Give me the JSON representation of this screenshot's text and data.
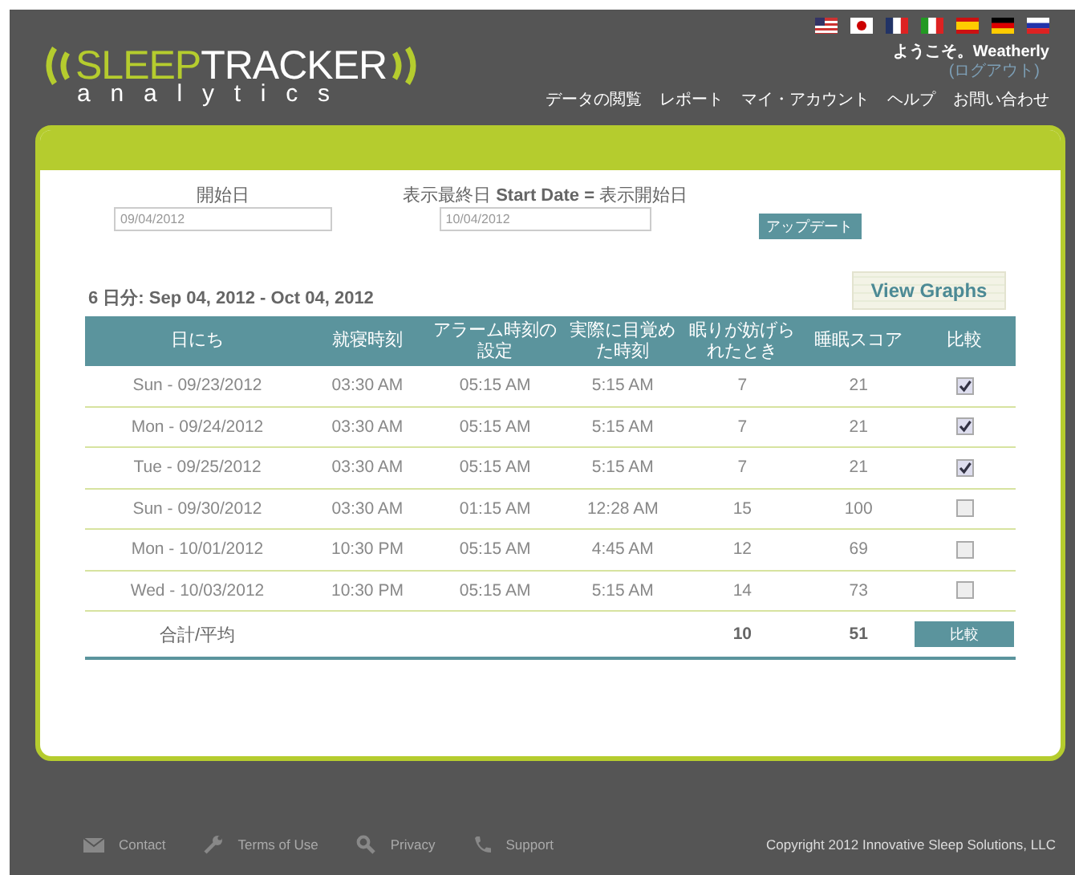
{
  "header": {
    "logo": {
      "brand_a": "SLEEP",
      "brand_b": "TRACKER",
      "tagline": "analytics"
    },
    "welcome": "ようこそ。Weatherly",
    "logout": "(ログアウト)",
    "nav": [
      "データの閲覧",
      "レポート",
      "マイ・アカウント",
      "ヘルプ",
      "お問い合わせ"
    ]
  },
  "filters": {
    "start_label": "開始日",
    "start_value": "09/04/2012",
    "end_label": "表示最終日 **Start Date =** 表示開始日",
    "end_value": "10/04/2012",
    "update_button": "アップデート"
  },
  "summary": {
    "range": "6 日分: Sep 04, 2012 - Oct 04, 2012",
    "view_graphs": "View Graphs"
  },
  "table": {
    "columns": [
      "日にち",
      "就寝時刻",
      "アラーム時刻の設定",
      "実際に目覚めた時刻",
      "眠りが妨げられたとき",
      "睡眠スコア",
      "比較"
    ],
    "rows": [
      {
        "cells": [
          "Sun - 09/23/2012",
          "03:30 AM",
          "05:15 AM",
          "5:15 AM",
          "7",
          "21"
        ],
        "checked": true
      },
      {
        "cells": [
          "Mon - 09/24/2012",
          "03:30 AM",
          "05:15 AM",
          "5:15 AM",
          "7",
          "21"
        ],
        "checked": true
      },
      {
        "cells": [
          "Tue - 09/25/2012",
          "03:30 AM",
          "05:15 AM",
          "5:15 AM",
          "7",
          "21"
        ],
        "checked": true
      },
      {
        "cells": [
          "Sun - 09/30/2012",
          "03:30 AM",
          "01:15 AM",
          "12:28 AM",
          "15",
          "100"
        ],
        "checked": false
      },
      {
        "cells": [
          "Mon - 10/01/2012",
          "10:30 PM",
          "05:15 AM",
          "4:45 AM",
          "12",
          "69"
        ],
        "checked": false
      },
      {
        "cells": [
          "Wed - 10/03/2012",
          "10:30 PM",
          "05:15 AM",
          "5:15 AM",
          "14",
          "73"
        ],
        "checked": false
      }
    ],
    "totals": {
      "label": "合計/平均",
      "interruptions": "10",
      "score": "51",
      "compare_button": "比較"
    }
  },
  "footer": {
    "links": [
      {
        "kind": "mail",
        "label": "Contact"
      },
      {
        "kind": "wrench",
        "label": "Terms of Use"
      },
      {
        "kind": "search",
        "label": "Privacy"
      },
      {
        "kind": "phone",
        "label": "Support"
      }
    ],
    "copyright": "Copyright 2012 Innovative Sleep Solutions, LLC"
  }
}
